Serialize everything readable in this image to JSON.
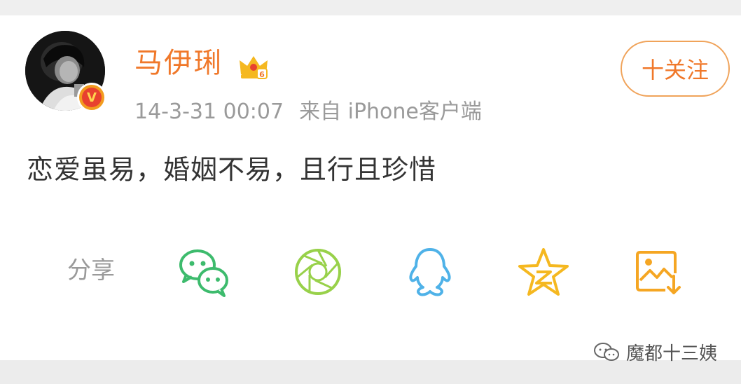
{
  "post": {
    "username": "马伊琍",
    "time": "14-3-31 00:07",
    "source": "来自 iPhone客户端",
    "text": "恋爱虽易，婚姻不易，且行且珍惜",
    "verified_mark": "V"
  },
  "actions": {
    "follow_label": "十关注"
  },
  "share": {
    "label": "分享",
    "targets": [
      "wechat-icon",
      "moments-icon",
      "qq-icon",
      "qzone-icon",
      "save-image-icon"
    ]
  },
  "watermark": {
    "text": "魔都十三姨"
  },
  "colors": {
    "accent": "#f0782a",
    "follow_border": "#f0a35a",
    "wechat": "#3dbb6d",
    "moments": "#98d14a",
    "qq": "#4fb2e8",
    "qzone": "#f5b820",
    "save": "#f5a623",
    "meta_text": "#9a9a9a",
    "body_text": "#333333"
  }
}
